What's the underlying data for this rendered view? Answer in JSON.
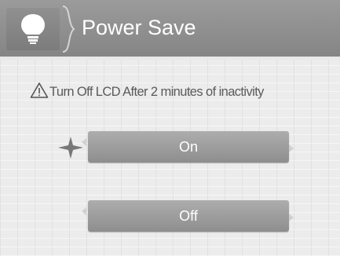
{
  "header": {
    "title": "Power Save",
    "icon": "lightbulb-icon",
    "background": "#8e8e8e"
  },
  "message": {
    "icon": "warning-icon",
    "text": "Turn Off LCD After 2 minutes of inactivity"
  },
  "options": [
    {
      "label": "On",
      "selected": true,
      "indicator_icon": "four-point-star-icon"
    },
    {
      "label": "Off",
      "selected": false
    }
  ],
  "colors": {
    "header_bg": "#8e8e8e",
    "button_bg": "#9f9f9f",
    "text_light": "#ffffff",
    "text_dark": "#5a5a5a",
    "page_bg": "#ececec"
  }
}
